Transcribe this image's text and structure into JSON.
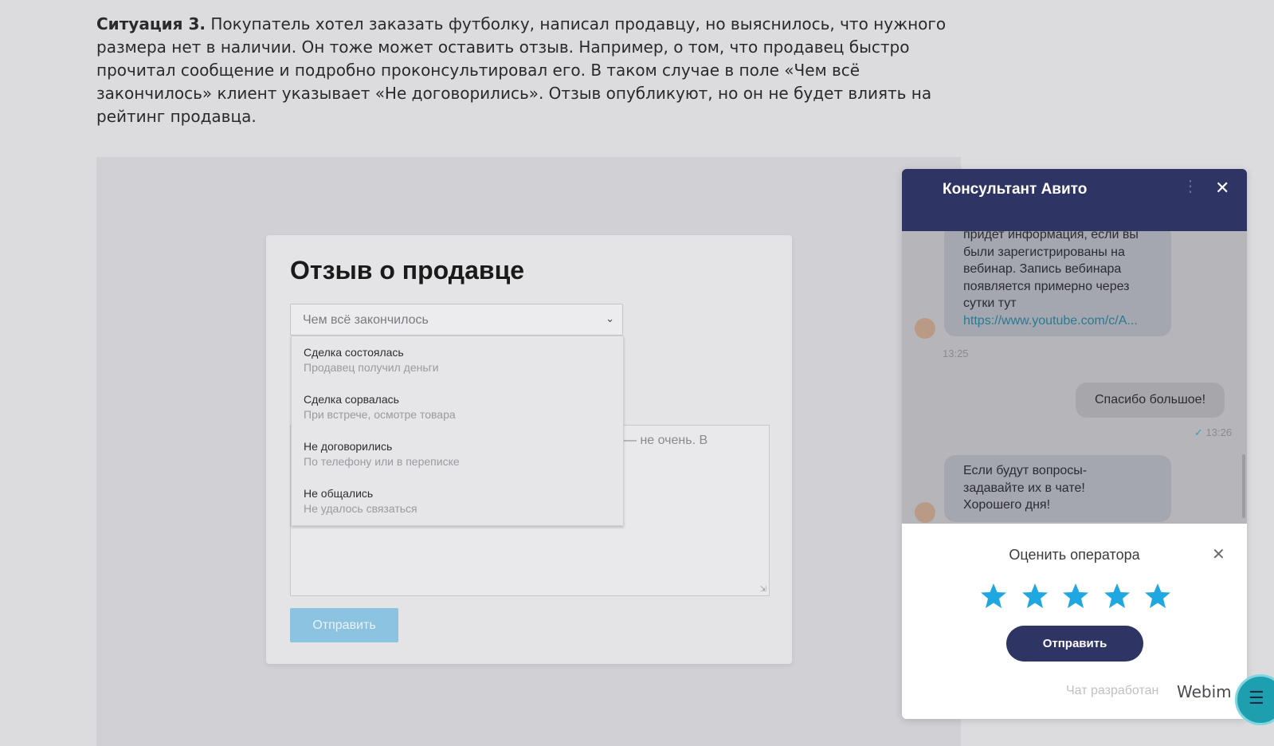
{
  "article": {
    "lead": "Ситуация 3.",
    "text": " Покупатель хотел заказать футболку, написал продавцу, но выяснилось, что нужного размера нет в наличии. Он тоже может оставить отзыв. Например, о том, что продавец быстро прочитал сообщение и подробно проконсультировал его. В таком случае в поле «Чем всё закончилось» клиент указывает «Не договорились». Отзыв опубликуют, но он не будет влиять на рейтинг продавца."
  },
  "review": {
    "title": "Отзыв о продавце",
    "select_value": "Чем всё закончилось",
    "options": [
      {
        "title": "Сделка состоялась",
        "subtitle": "Продавец получил деньги"
      },
      {
        "title": "Сделка сорвалась",
        "subtitle": "При встрече, осмотре товара"
      },
      {
        "title": "Не договорились",
        "subtitle": "По телефону или в переписке"
      },
      {
        "title": "Не общались",
        "subtitle": "Не удалось связаться"
      }
    ],
    "textarea_tail": "— не очень. В",
    "submit_label": "Отправить"
  },
  "chat": {
    "title": "Консультант Авито",
    "messages": [
      {
        "from": "operator",
        "lines": [
          "придет информация, если вы",
          "были зарегистрированы на",
          "вебинар. Запись вебинара",
          "появляется примерно через",
          "сутки тут"
        ],
        "link": "https://www.youtube.com/c/A...",
        "time": "13:25"
      },
      {
        "from": "user",
        "text": "Спасибо большое!",
        "time": "13:26"
      },
      {
        "from": "operator",
        "lines": [
          "Если будут вопросы-",
          "задавайте их в чате!",
          "Хорошего дня!"
        ]
      }
    ],
    "rating": {
      "title": "Оценить оператора",
      "stars": 5,
      "star_color": "#1ea7e0",
      "send_label": "Отправить"
    },
    "powered_by": "Чат разработан",
    "brand": "Webim",
    "header_color": "#2e3464"
  }
}
